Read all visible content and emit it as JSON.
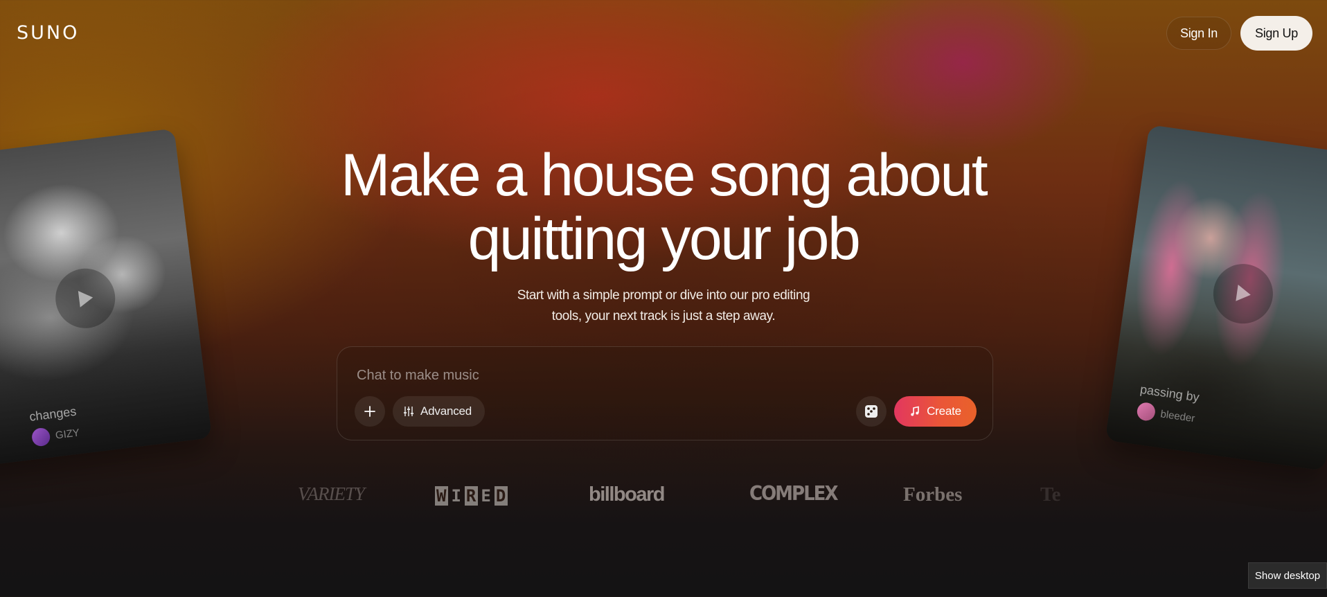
{
  "brand": {
    "logo_text": "SUNO"
  },
  "header": {
    "sign_in_label": "Sign In",
    "sign_up_label": "Sign Up"
  },
  "hero": {
    "headline_line1": "Make a house song about",
    "headline_line2": "quitting your job",
    "subtitle_line1": "Start with a simple prompt or dive into our pro editing",
    "subtitle_line2": "tools, your next track is just a step away."
  },
  "chat": {
    "placeholder": "Chat to make music",
    "value": "",
    "add_icon": "plus-icon",
    "advanced_label": "Advanced",
    "advanced_icon": "sliders-icon",
    "random_icon": "dice-icon",
    "create_label": "Create",
    "create_icon": "music-note-icon"
  },
  "cards": [
    {
      "title": "changes",
      "artist": "GIZY",
      "icon": "play-icon"
    },
    {
      "title": "passing by",
      "artist": "bleeder",
      "icon": "play-icon"
    }
  ],
  "press_logos": [
    "VARIETY",
    "WIRED",
    "billboard",
    "COMPLEX",
    "Forbes",
    "Te"
  ],
  "taskbar": {
    "show_desktop_label": "Show desktop"
  },
  "colors": {
    "create_gradient_start": "#e2375f",
    "create_gradient_end": "#e9622a",
    "sign_up_bg": "#f4efe9"
  }
}
